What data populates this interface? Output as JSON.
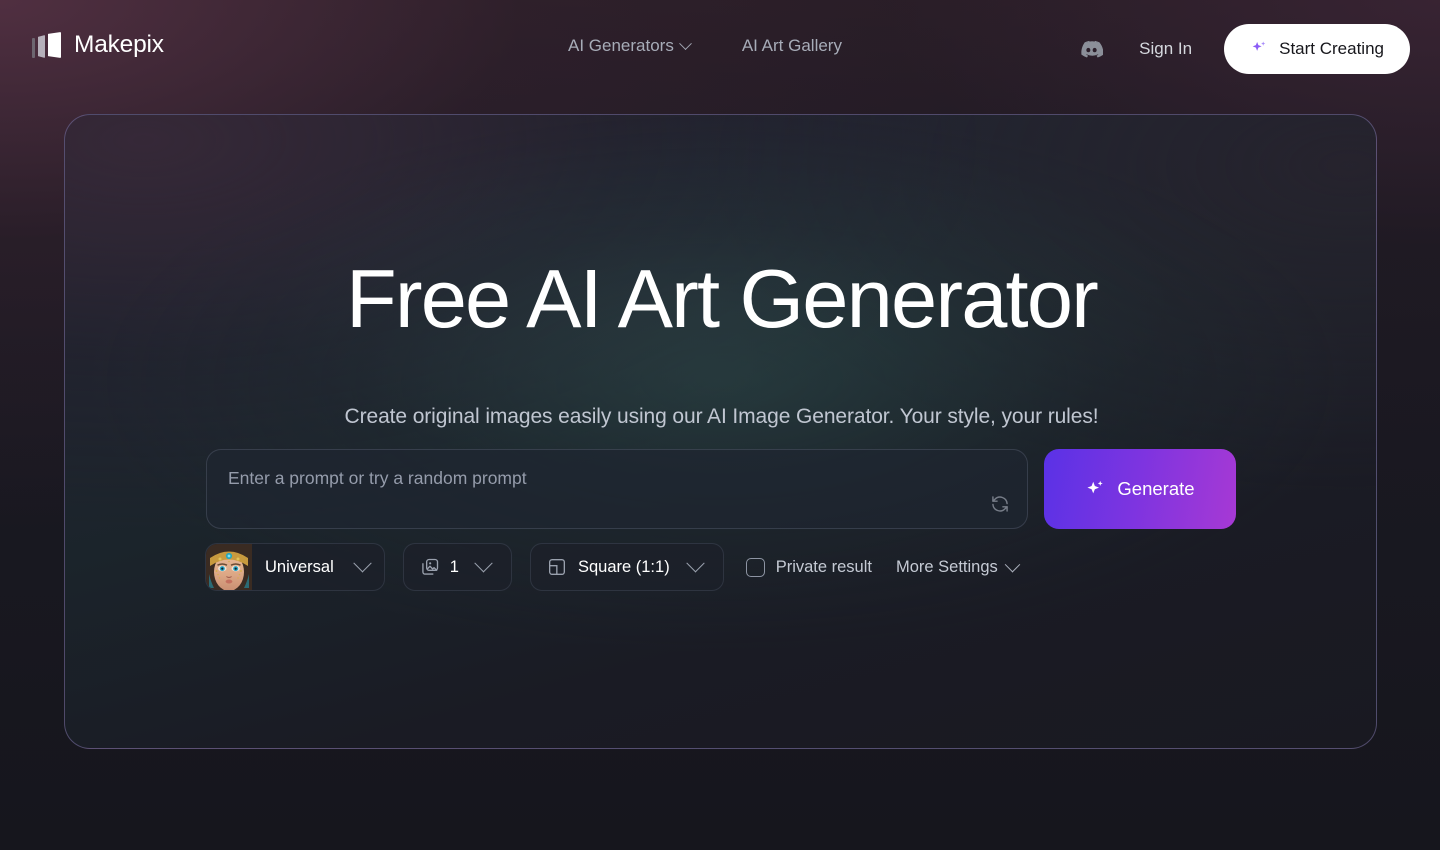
{
  "header": {
    "brand": {
      "name": "Makepix",
      "logo_icon": "makepix-bars-logo"
    },
    "nav": [
      {
        "label": "AI Generators",
        "has_dropdown": true
      },
      {
        "label": "AI Art Gallery",
        "has_dropdown": false
      }
    ],
    "discord_icon": "discord-icon",
    "sign_in": "Sign In",
    "cta": {
      "label": "Start Creating",
      "icon": "sparkle-icon",
      "bg": "#ffffff",
      "text_color": "#17171c"
    }
  },
  "hero": {
    "title": "Free AI Art Generator",
    "subtitle": "Create original images easily using our AI Image Generator. Your style, your rules!",
    "prompt": {
      "value": "",
      "placeholder": "Enter a prompt or try a random prompt",
      "shuffle_icon": "refresh-random-prompt-icon"
    },
    "generate": {
      "label": "Generate",
      "icon": "sparkle-icon",
      "gradient_from": "#5a32e6",
      "gradient_to": "#a739d4"
    },
    "controls": {
      "style": {
        "label": "Universal",
        "thumbnail_icon": "style-thumbnail-fantasy-portrait",
        "caret": "chevron-down-icon"
      },
      "count": {
        "value": "1",
        "icon": "images-stack-icon",
        "caret": "chevron-down-icon"
      },
      "aspect_ratio": {
        "label": "Square (1:1)",
        "icon": "aspect-ratio-icon",
        "caret": "chevron-down-icon"
      },
      "private_result": {
        "label": "Private result",
        "checked": false
      },
      "more_settings": {
        "label": "More Settings",
        "caret": "chevron-down-icon"
      }
    }
  },
  "theme": {
    "page_bg": "#16161c",
    "card_border": "#7e72a8",
    "accent_purple": "#7d34e0",
    "text_primary": "#ffffff",
    "text_muted": "#a7acb8"
  }
}
